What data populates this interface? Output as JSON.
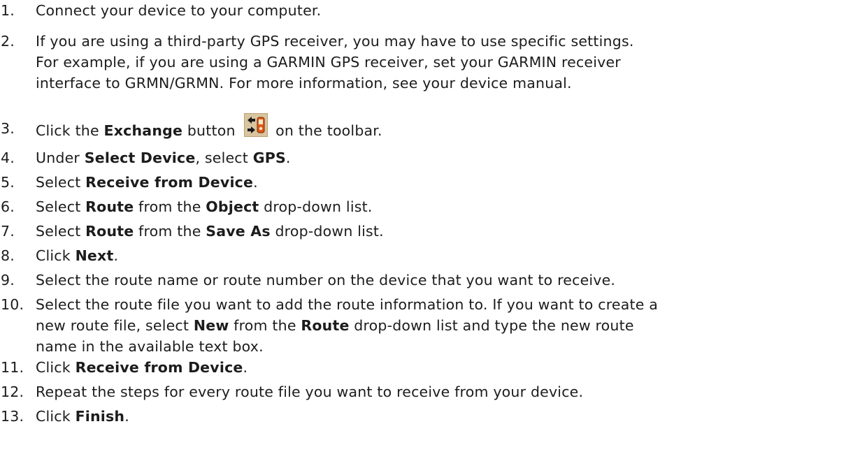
{
  "steps": [
    {
      "num": "1.",
      "parts": [
        {
          "t": "Connect your device to your computer."
        }
      ]
    },
    {
      "num": "2.",
      "parts": [
        {
          "t": "If you are using a third-party GPS receiver, you may have to use specific settings."
        }
      ],
      "lines": [
        "For example, if you are using a GARMIN GPS receiver, set your GARMIN receiver",
        "interface to GRMN/GRMN. For more information, see your device manual."
      ]
    },
    {
      "num": "3.",
      "parts": [
        {
          "t": "Click the "
        },
        {
          "b": "Exchange"
        },
        {
          "t": " button "
        },
        {
          "icon": "exchange-icon"
        },
        {
          "t": " on the toolbar."
        }
      ]
    },
    {
      "num": "4.",
      "parts": [
        {
          "t": "Under "
        },
        {
          "b": "Select Device"
        },
        {
          "t": ", select "
        },
        {
          "b": "GPS"
        },
        {
          "t": "."
        }
      ]
    },
    {
      "num": "5.",
      "parts": [
        {
          "t": "Select "
        },
        {
          "b": "Receive from Device"
        },
        {
          "t": "."
        }
      ]
    },
    {
      "num": "6.",
      "parts": [
        {
          "t": "Select "
        },
        {
          "b": "Route"
        },
        {
          "t": " from the "
        },
        {
          "b": "Object"
        },
        {
          "t": " drop-down list."
        }
      ]
    },
    {
      "num": "7.",
      "parts": [
        {
          "t": "Select "
        },
        {
          "b": "Route"
        },
        {
          "t": " from the "
        },
        {
          "b": "Save As"
        },
        {
          "t": " drop-down list."
        }
      ]
    },
    {
      "num": "8.",
      "parts": [
        {
          "t": "Click "
        },
        {
          "b": "Next"
        },
        {
          "t": "."
        }
      ]
    },
    {
      "num": "9.",
      "parts": [
        {
          "t": "Select the route name or route number on the device that you want to receive."
        }
      ]
    },
    {
      "num": "10.",
      "parts": [
        {
          "t": "Select the route file you want to add the route information to. If you want to create a"
        }
      ],
      "lines2": [
        [
          {
            "t": "new route file, select "
          },
          {
            "b": "New"
          },
          {
            "t": " from the "
          },
          {
            "b": "Route"
          },
          {
            "t": " drop-down list and type the new route"
          }
        ],
        [
          {
            "t": "name in the available text box."
          }
        ]
      ]
    },
    {
      "num": "11.",
      "parts": [
        {
          "t": "Click "
        },
        {
          "b": "Receive from Device"
        },
        {
          "t": "."
        }
      ]
    },
    {
      "num": "12.",
      "parts": [
        {
          "t": "Repeat the steps for every route file you want to receive from your device."
        }
      ]
    },
    {
      "num": "13.",
      "parts": [
        {
          "t": "Click "
        },
        {
          "b": "Finish"
        },
        {
          "t": "."
        }
      ]
    }
  ]
}
